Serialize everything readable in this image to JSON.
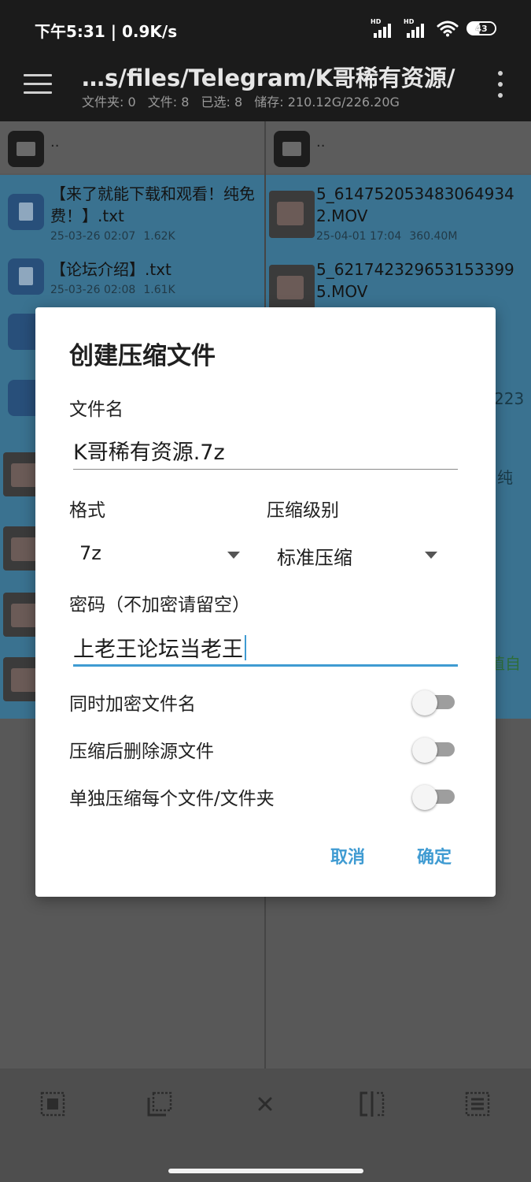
{
  "status_bar": {
    "time": "下午5:31 | 0.9K/s",
    "network_label": "HD",
    "battery": "43"
  },
  "app_bar": {
    "path": "…s/files/Telegram/K哥稀有资源/",
    "stats": [
      "文件夹: 0",
      "文件: 8",
      "已选: 8",
      "储存: 210.12G/226.20G"
    ]
  },
  "left_pane": {
    "parent": "..",
    "files": [
      {
        "name": "【来了就能下载和观看！纯免费！】.txt",
        "date": "25-03-26 02:07",
        "size": "1.62K"
      },
      {
        "name": "【论坛介绍】.txt",
        "date": "25-03-26 02:08",
        "size": "1.61K"
      }
    ]
  },
  "right_pane": {
    "parent": "..",
    "files": [
      {
        "name": "5_6147520534830649342.MOV",
        "date": "25-04-01 17:04",
        "size": "360.40M"
      },
      {
        "name": "5_6217423296531533995.MOV"
      }
    ],
    "peek_texts": [
      "223",
      "纯",
      "值自"
    ]
  },
  "dialog": {
    "title": "创建压缩文件",
    "filename_label": "文件名",
    "filename_value": "K哥稀有资源.7z",
    "format_label": "格式",
    "format_value": "7z",
    "level_label": "压缩级别",
    "level_value": "标准压缩",
    "password_label": "密码（不加密请留空）",
    "password_value": "上老王论坛当老王",
    "toggles": [
      {
        "label": "同时加密文件名",
        "on": false
      },
      {
        "label": "压缩后删除源文件",
        "on": false
      },
      {
        "label": "单独压缩每个文件/文件夹",
        "on": false
      }
    ],
    "cancel": "取消",
    "confirm": "确定"
  },
  "colors": {
    "accent": "#3f9bd2",
    "selection": "#3a7290",
    "app_bar": "#1b1b1b"
  },
  "toolbar_icons": [
    "select-all-icon",
    "invert-selection-icon",
    "close-icon",
    "split-view-icon",
    "list-select-icon"
  ]
}
